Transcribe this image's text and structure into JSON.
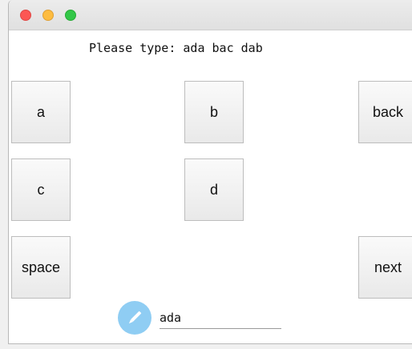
{
  "prompt": "Please type: ada bac dab",
  "keys": {
    "a": "a",
    "b": "b",
    "back": "back",
    "c": "c",
    "d": "d",
    "space": "space",
    "next": "next"
  },
  "input": {
    "value": "ada"
  },
  "icons": {
    "pencil": "pencil-icon"
  },
  "colors": {
    "close": "#fc5753",
    "minimize": "#fdbc40",
    "maximize": "#33c748",
    "pencil_circle": "#8fcdf3"
  }
}
